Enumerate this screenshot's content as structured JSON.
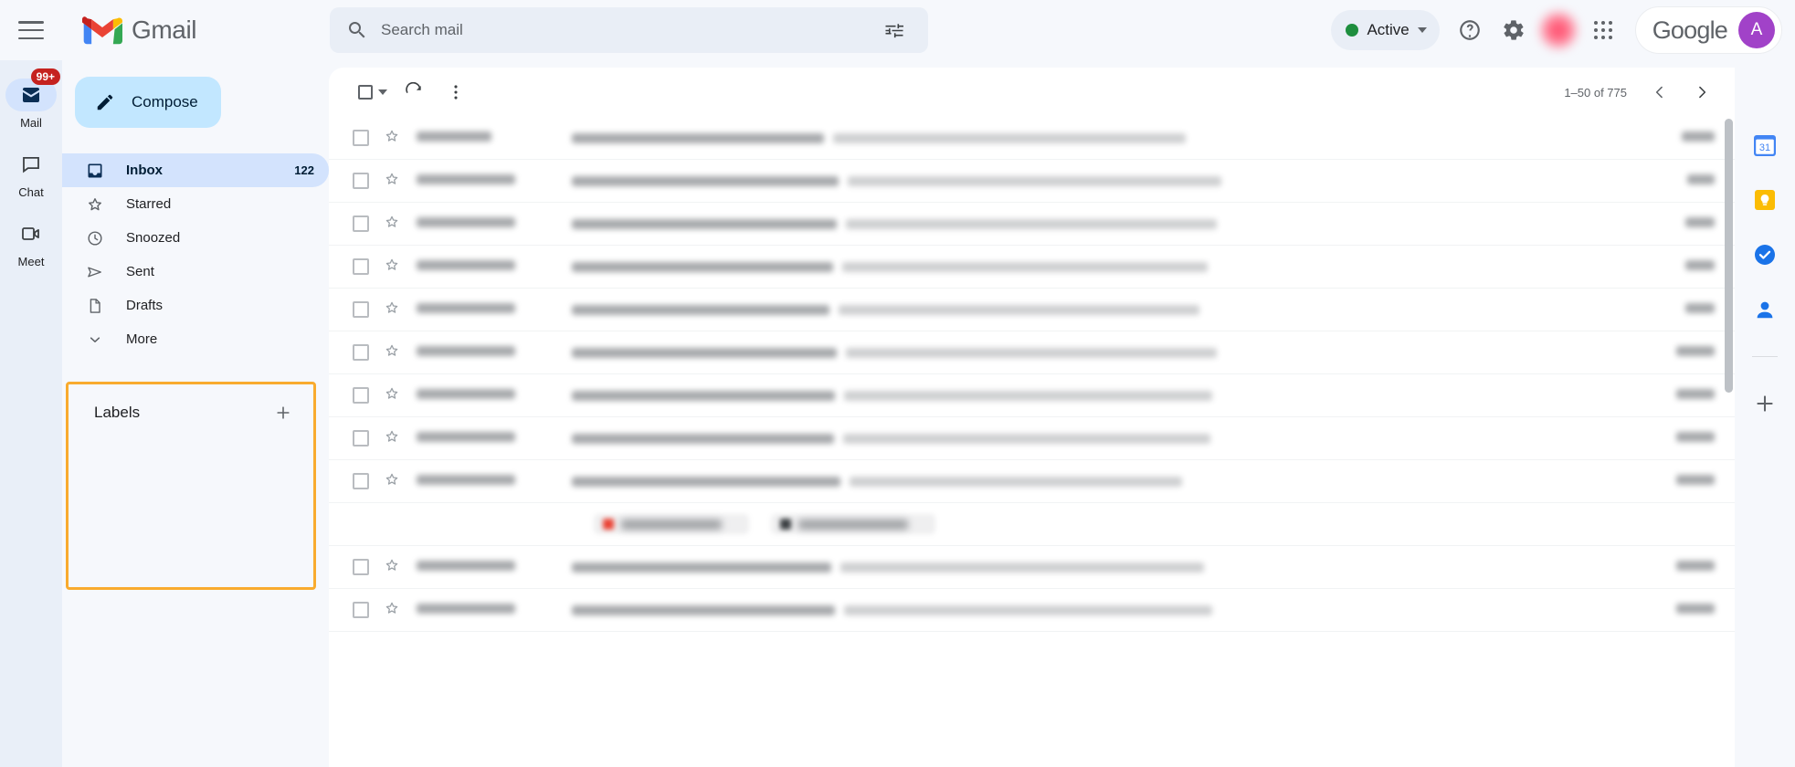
{
  "header": {
    "menu_icon": "hamburger-menu-icon",
    "brand": "Gmail",
    "brand_logo": "gmail-logo-icon",
    "search": {
      "placeholder": "Search mail",
      "value": "",
      "search_icon": "search-icon",
      "options_icon": "search-options-icon"
    },
    "status": {
      "label": "Active",
      "dot_color": "#1e8e3e",
      "chevron_icon": "chevron-down-icon"
    },
    "help_icon": "help-circle-icon",
    "settings_icon": "gear-icon",
    "apps_icon": "google-apps-grid-icon",
    "google_label": "Google",
    "avatar_letter": "A",
    "avatar_color": "#a142c8"
  },
  "rail": {
    "items": [
      {
        "label": "Mail",
        "icon": "mail-icon",
        "badge": "99+",
        "active": true
      },
      {
        "label": "Chat",
        "icon": "chat-bubble-icon",
        "badge": "",
        "active": false
      },
      {
        "label": "Meet",
        "icon": "video-camera-icon",
        "badge": "",
        "active": false
      }
    ]
  },
  "sidebar": {
    "compose": {
      "label": "Compose",
      "icon": "pencil-icon"
    },
    "nav": [
      {
        "label": "Inbox",
        "icon": "inbox-icon",
        "count": "122",
        "active": true
      },
      {
        "label": "Starred",
        "icon": "star-icon",
        "count": "",
        "active": false
      },
      {
        "label": "Snoozed",
        "icon": "clock-icon",
        "count": "",
        "active": false
      },
      {
        "label": "Sent",
        "icon": "send-icon",
        "count": "",
        "active": false
      },
      {
        "label": "Drafts",
        "icon": "document-icon",
        "count": "",
        "active": false
      },
      {
        "label": "More",
        "icon": "chevron-down-icon",
        "count": "",
        "active": false
      }
    ],
    "labels": {
      "title": "Labels",
      "add_label_icon": "plus-icon",
      "highlight_color": "#f9ab2e"
    }
  },
  "toolbar": {
    "select_all_icon": "checkbox-icon",
    "select_all_caret_icon": "caret-down-icon",
    "refresh_icon": "refresh-icon",
    "more_icon": "more-vertical-icon",
    "pagination": "1–50 of 775",
    "prev_icon": "chevron-left-icon",
    "next_icon": "chevron-right-icon"
  },
  "maillist": {
    "rows": [
      {
        "sender_w": 82,
        "subject_w": 690,
        "date_w": 36,
        "has_chips": false
      },
      {
        "sender_w": 108,
        "subject_w": 730,
        "date_w": 30,
        "has_chips": false
      },
      {
        "sender_w": 108,
        "subject_w": 725,
        "date_w": 32,
        "has_chips": false
      },
      {
        "sender_w": 108,
        "subject_w": 715,
        "date_w": 32,
        "has_chips": false
      },
      {
        "sender_w": 108,
        "subject_w": 705,
        "date_w": 32,
        "has_chips": false
      },
      {
        "sender_w": 108,
        "subject_w": 725,
        "date_w": 42,
        "has_chips": false
      },
      {
        "sender_w": 108,
        "subject_w": 720,
        "date_w": 42,
        "has_chips": false
      },
      {
        "sender_w": 108,
        "subject_w": 718,
        "date_w": 42,
        "has_chips": false
      },
      {
        "sender_w": 108,
        "subject_w": 700,
        "date_w": 42,
        "has_chips": true
      },
      {
        "sender_w": 108,
        "subject_w": 710,
        "date_w": 42,
        "has_chips": false
      },
      {
        "sender_w": 108,
        "subject_w": 720,
        "date_w": 42,
        "has_chips": false
      }
    ]
  },
  "siderail": {
    "items": [
      {
        "icon": "calendar-icon",
        "name": "google-calendar"
      },
      {
        "icon": "keep-icon",
        "name": "google-keep"
      },
      {
        "icon": "tasks-icon",
        "name": "google-tasks"
      },
      {
        "icon": "contacts-icon",
        "name": "google-contacts"
      },
      {
        "icon": "plus-icon",
        "name": "add-app"
      }
    ]
  }
}
